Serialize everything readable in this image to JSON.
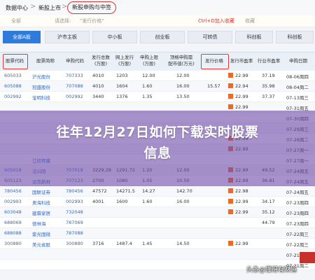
{
  "breadcrumb": {
    "home": "数据中心",
    "parent": "新股上市",
    "active": "新股申购与中签",
    "sep": ">"
  },
  "hint": {
    "text_a": "全部",
    "text_b": "请选择:",
    "text_c": "\"发行价格\"",
    "text_d": "Ctrl+D加入收藏",
    "text_e": "收藏"
  },
  "tabs": [
    "全部A股",
    "沪市主板",
    "中小板",
    "创业板",
    "可转债",
    "科创板",
    "科创板"
  ],
  "columns": [
    "股票代码",
    "股票简称",
    "申购代码",
    "发行总数\n(万股)",
    "网上发行\n(万股)",
    "申购上限\n(万股)",
    "顶格申购需\n配市值(万元)",
    "发行价格",
    "发行市盈率",
    "行业市盈率",
    "申购日期"
  ],
  "rows": [
    {
      "code": "605033",
      "name": "沪光股份",
      "sub": "707333",
      "a": "4010",
      "b": "1203",
      "c": "12.00",
      "d": "12.00",
      "price": "",
      "pe": "22.99",
      "ipe": "37.19",
      "date": "08-06周四"
    },
    {
      "code": "605088",
      "name": "冠盛股份",
      "sub": "707088",
      "a": "4010",
      "b": "1604",
      "c": "1.60",
      "d": "16.00",
      "price": "15.57",
      "pe": "22.94",
      "ipe": "35.98",
      "date": "08-04周二"
    },
    {
      "code": "002992",
      "name": "宝明科技",
      "sub": "002992",
      "a": "3440",
      "b": "1376",
      "c": "1.35",
      "d": "13.50",
      "price": "",
      "pe": "22.99",
      "ipe": "37.37",
      "date": "07-13周三"
    },
    {
      "code": "",
      "name": "",
      "sub": "",
      "a": "",
      "b": "",
      "c": "",
      "d": "",
      "price": "",
      "pe": "22.99",
      "ipe": "",
      "date": "07-31周五"
    },
    {
      "code": "",
      "name": "",
      "sub": "",
      "a": "",
      "b": "",
      "c": "",
      "d": "",
      "price": "",
      "pe": "",
      "ipe": "",
      "date": "07-30周四"
    },
    {
      "code": "",
      "name": "",
      "sub": "",
      "a": "",
      "b": "",
      "c": "",
      "d": "",
      "price": "",
      "pe": "",
      "ipe": "",
      "date": "07-29周三"
    },
    {
      "code": "",
      "name": "",
      "sub": "",
      "a": "",
      "b": "",
      "c": "",
      "d": "",
      "price": "",
      "pe": "22.99",
      "ipe": "",
      "date": "07-28周二"
    },
    {
      "code": "",
      "name": "",
      "sub": "",
      "a": "",
      "b": "",
      "c": "",
      "d": "",
      "price": "",
      "pe": "22.99",
      "ipe": "",
      "date": "07-27周一"
    },
    {
      "code": "",
      "name": "江欣传媒",
      "sub": "",
      "a": "",
      "b": "",
      "c": "",
      "d": "",
      "price": "",
      "pe": "",
      "ipe": "",
      "date": "07-27周一"
    },
    {
      "code": "605018",
      "name": "法兴阳",
      "sub": "707018",
      "a": "3229.28",
      "b": "1291.72",
      "c": "1.20",
      "d": "12.00",
      "price": "",
      "pe": "22.99",
      "ipe": "49.52",
      "date": "07-24周五"
    },
    {
      "code": "605123",
      "name": "派克新材",
      "sub": "707123",
      "a": "2700",
      "b": "1080",
      "c": "1.05",
      "d": "10.50",
      "price": "",
      "pe": "22.99",
      "ipe": "36.81",
      "date": "07-24周五"
    },
    {
      "code": "780456",
      "name": "国联证券",
      "sub": "780456",
      "a": "47572",
      "b": "14271.5",
      "c": "14.27",
      "d": "142.70",
      "price": "",
      "pe": "22.98",
      "ipe": "",
      "date": "07-24周五"
    },
    {
      "code": "002993",
      "name": "奥海科技",
      "sub": "002993",
      "a": "4001",
      "b": "1600",
      "c": "1.60",
      "d": "16.00",
      "price": "",
      "pe": "22.99",
      "ipe": "34.17",
      "date": "07-23周四"
    },
    {
      "code": "603048",
      "name": "建霖家居",
      "sub": "732048",
      "a": "",
      "b": "",
      "c": "",
      "d": "",
      "price": "",
      "pe": "22.99",
      "ipe": "35.12",
      "date": "07-23周四"
    },
    {
      "code": "688069",
      "name": "德林海",
      "sub": "787069",
      "a": "",
      "b": "",
      "c": "",
      "d": "",
      "price": "",
      "pe": "",
      "ipe": "44.79",
      "date": "07-23周四"
    },
    {
      "code": "688088",
      "name": "紫光国微",
      "sub": "787088",
      "a": "",
      "b": "",
      "c": "",
      "d": "",
      "price": "",
      "pe": "",
      "ipe": "",
      "date": "07-22周三"
    },
    {
      "code": "300880",
      "name": "美元省股",
      "sub": "300880",
      "a": "3716",
      "b": "1487.4",
      "c": "1.45",
      "d": "14.50",
      "price": "",
      "pe": "22.99",
      "ipe": "",
      "date": "07-22周三"
    },
    {
      "code": "",
      "name": "",
      "sub": "",
      "a": "",
      "b": "",
      "c": "",
      "d": "",
      "price": "",
      "pe": "",
      "ipe": "",
      "date": "07-21周二"
    },
    {
      "code": "",
      "name": "",
      "sub": "",
      "a": "",
      "b": "",
      "c": "",
      "d": "",
      "price": "",
      "pe": "",
      "ipe": "",
      "date": "07-21周二"
    }
  ],
  "title_line1": "往年12月27日如何下载实时股票",
  "title_line2": "信息",
  "watermark": "头条@懂得有财道"
}
